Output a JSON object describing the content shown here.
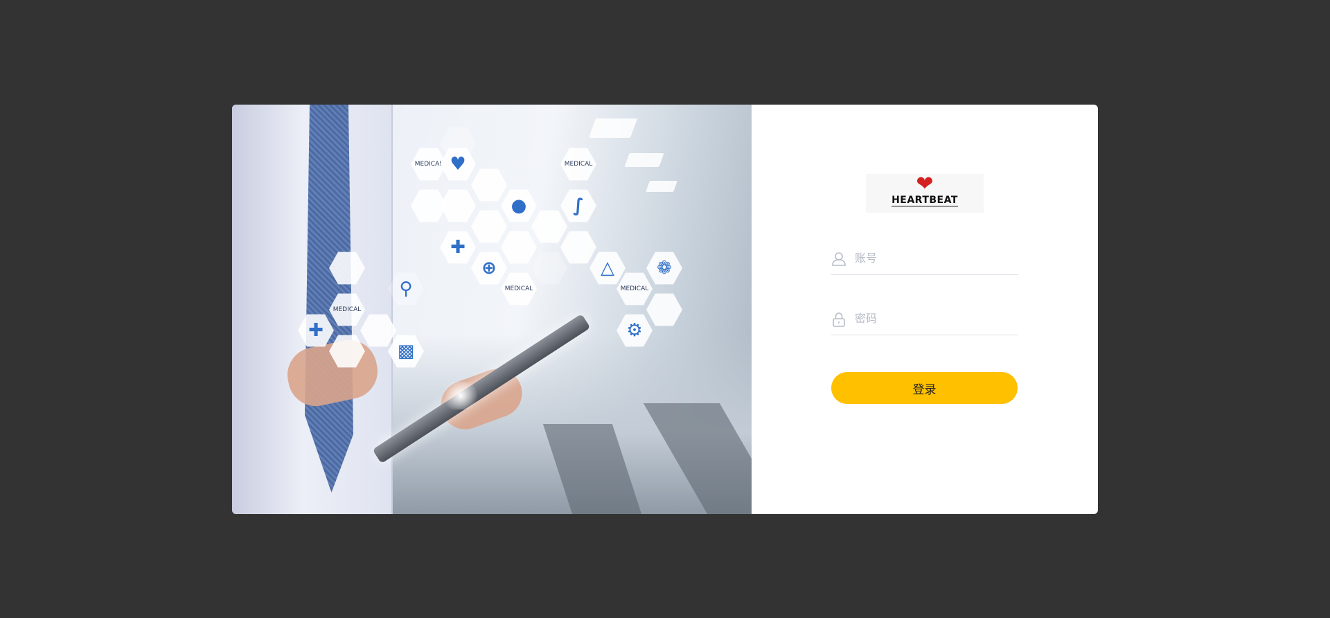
{
  "hero": {
    "hex_labels": [
      "MEDICAL",
      "MEDICAL",
      "MEDICAL",
      "MEDICAL",
      "MEDICAL"
    ]
  },
  "logo": {
    "text": "HEARTBEAT"
  },
  "form": {
    "account_placeholder": "账号",
    "password_placeholder": "密码",
    "login_label": "登录"
  },
  "colors": {
    "background": "#333333",
    "card": "#ffffff",
    "login_button": "#ffc000",
    "icon": "#b8bcc6"
  }
}
